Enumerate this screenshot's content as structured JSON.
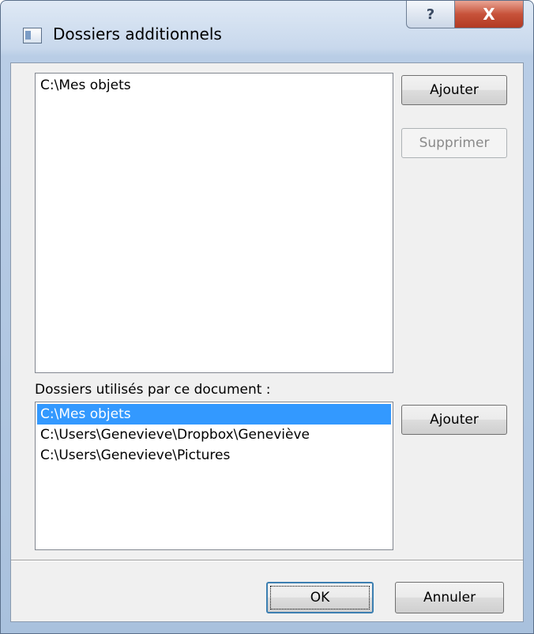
{
  "window": {
    "title": "Dossiers additionnels",
    "help_glyph": "?",
    "close_glyph": "X"
  },
  "top_section": {
    "items": [
      "C:\\Mes objets"
    ],
    "add_label": "Ajouter",
    "remove_label": "Supprimer",
    "remove_enabled": false
  },
  "bottom_section": {
    "label": "Dossiers utilisés par ce document :",
    "items": [
      "C:\\Mes objets",
      "C:\\Users\\Genevieve\\Dropbox\\Geneviève",
      "C:\\Users\\Genevieve\\Pictures"
    ],
    "selected_index": 0,
    "add_label": "Ajouter"
  },
  "footer": {
    "ok_label": "OK",
    "cancel_label": "Annuler"
  },
  "colors": {
    "selection": "#3399ff",
    "close_button": "#c7523a",
    "title_gradient": "#c8d8ec"
  }
}
